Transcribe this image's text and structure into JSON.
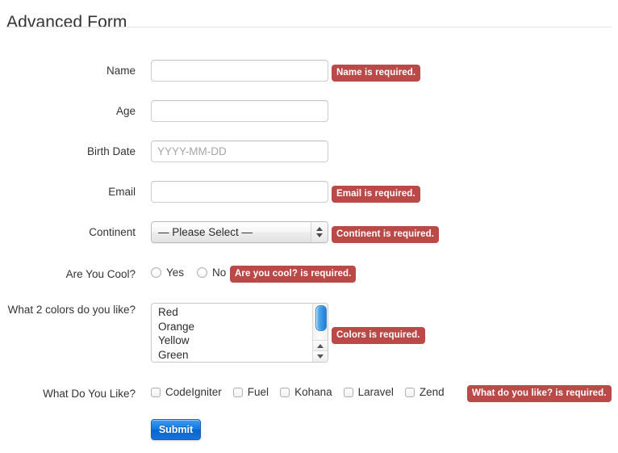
{
  "header": {
    "title": "Advanced Form"
  },
  "fields": {
    "name": {
      "label": "Name",
      "value": "",
      "placeholder": "",
      "error": "Name is required."
    },
    "age": {
      "label": "Age",
      "value": "",
      "placeholder": "",
      "error": ""
    },
    "birth_date": {
      "label": "Birth Date",
      "value": "",
      "placeholder": "YYYY-MM-DD",
      "error": ""
    },
    "email": {
      "label": "Email",
      "value": "",
      "placeholder": "",
      "error": "Email is required."
    },
    "continent": {
      "label": "Continent",
      "selected": "— Please Select —",
      "error": "Continent is required."
    },
    "are_you_cool": {
      "label": "Are You Cool?",
      "options": [
        {
          "label": "Yes",
          "checked": false
        },
        {
          "label": "No",
          "checked": false
        }
      ],
      "error": "Are you cool? is required."
    },
    "colors": {
      "label": "What 2 colors do you like?",
      "options": [
        {
          "label": "Red",
          "selected": false
        },
        {
          "label": "Orange",
          "selected": false
        },
        {
          "label": "Yellow",
          "selected": false
        },
        {
          "label": "Green",
          "selected": false
        }
      ],
      "error": "Colors is required."
    },
    "what_do_you_like": {
      "label": "What Do You Like?",
      "options": [
        {
          "label": "CodeIgniter",
          "checked": false
        },
        {
          "label": "Fuel",
          "checked": false
        },
        {
          "label": "Kohana",
          "checked": false
        },
        {
          "label": "Laravel",
          "checked": false
        },
        {
          "label": "Zend",
          "checked": false
        }
      ],
      "error": "What do you like? is required."
    }
  },
  "actions": {
    "submit_label": "Submit"
  },
  "colors": {
    "error_background": "#b94a48",
    "error_text": "#ffffff",
    "submit_background": "#1278e2",
    "text": "#333333",
    "placeholder": "#a6a6a6",
    "input_border": "#cccccc",
    "divider": "#e2e2e2",
    "scrollbar_thumb": "#1f7fd6"
  }
}
